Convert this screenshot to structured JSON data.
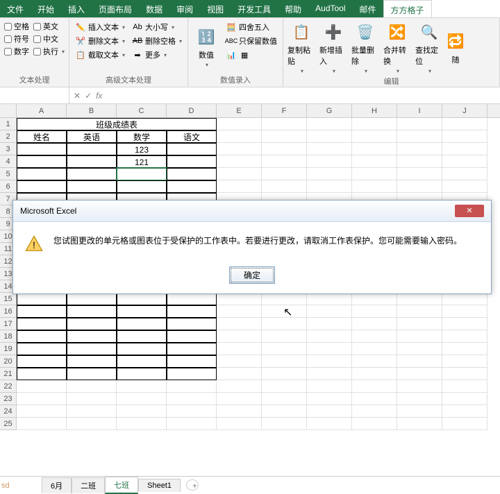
{
  "tabs": {
    "file": "文件",
    "home": "开始",
    "insert": "插入",
    "layout": "页面布局",
    "data": "数据",
    "review": "审阅",
    "view": "视图",
    "dev": "开发工具",
    "help": "帮助",
    "audtool": "AudTool",
    "mail": "邮件",
    "ffgz": "方方格子"
  },
  "ribbon": {
    "text_group": {
      "label": "文本处理",
      "space": "空格",
      "english": "英文",
      "symbol": "符号",
      "chinese": "中文",
      "number": "数字",
      "execute": "执行"
    },
    "adv_text_group": {
      "label": "高级文本处理",
      "insert": "插入文本",
      "case": "大小写",
      "delete": "删除文本",
      "del_space": "删除空格",
      "extract": "截取文本",
      "more": "更多"
    },
    "num_group": {
      "label": "数值录入",
      "value": "数值",
      "round": "四舍五入",
      "keep": "只保留数值"
    },
    "edit_group": {
      "label": "编辑",
      "copypaste": "复制粘贴",
      "insert_add": "新增插入",
      "batch_del": "批量删除",
      "merge": "合并转换",
      "find": "查找定位",
      "repeat": "随"
    }
  },
  "formula_bar": {
    "namebox": "",
    "fx": "fx"
  },
  "columns": [
    "A",
    "B",
    "C",
    "D",
    "E",
    "F",
    "G",
    "H",
    "I",
    "J"
  ],
  "sheet": {
    "title": "班级成绩表",
    "h_name": "姓名",
    "h_eng": "英语",
    "h_math": "数学",
    "h_cn": "语文",
    "r1_math": "123",
    "r2_math": "121"
  },
  "dialog": {
    "title": "Microsoft Excel",
    "message": "您试图更改的单元格或图表位于受保护的工作表中。若要进行更改，请取消工作表保护。您可能需要输入密码。",
    "ok": "确定"
  },
  "sheets": {
    "s1": "6月",
    "s2": "二班",
    "s3": "七班",
    "s4": "Sheet1"
  },
  "footer": "sd"
}
